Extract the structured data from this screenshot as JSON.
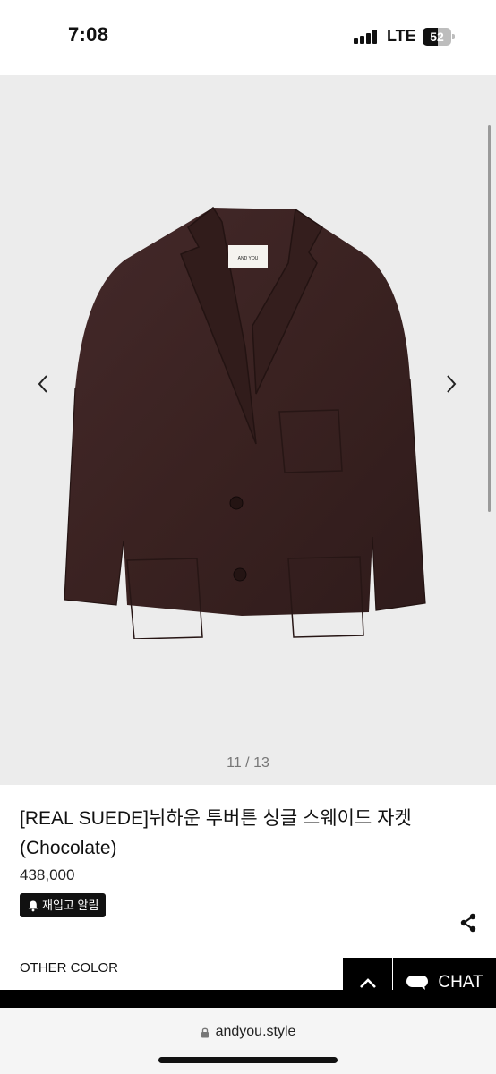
{
  "status_bar": {
    "time": "7:08",
    "network": "LTE",
    "battery": "52"
  },
  "gallery": {
    "counter": "11 / 13",
    "brand_tag_text": "AND YOU",
    "prev_icon": "chevron-left-icon",
    "next_icon": "chevron-right-icon",
    "background_color": "#ececec",
    "product_color": "#3b2420"
  },
  "product": {
    "title": "[REAL SUEDE]뉘하운 투버튼 싱글 스웨이드 자켓 (Chocolate)",
    "price": "438,000",
    "restock_label": "재입고 알림",
    "share_icon": "share-icon"
  },
  "sections": {
    "other_color": "OTHER COLOR"
  },
  "floating": {
    "scroll_top_icon": "chevron-up-icon",
    "chat_label": "CHAT"
  },
  "browser": {
    "url": "andyou.style"
  }
}
